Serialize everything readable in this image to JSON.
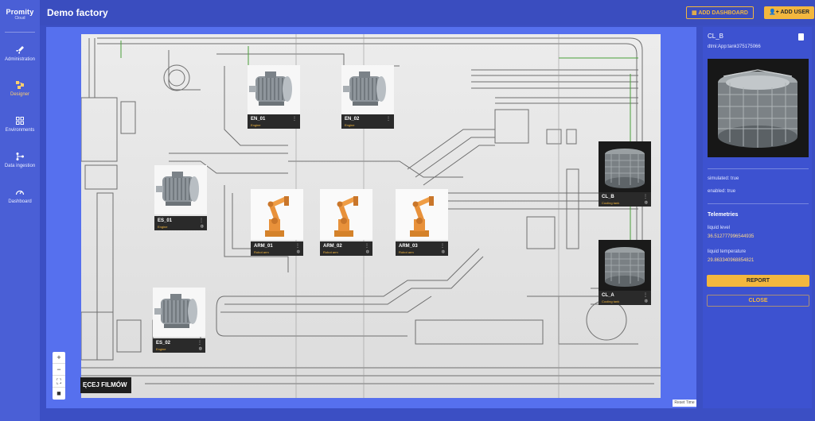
{
  "app": {
    "logo_text": "Promity",
    "logo_sub": "Cloud"
  },
  "sidebar": {
    "items": [
      {
        "label": "Administration",
        "icon": "rocket-icon"
      },
      {
        "label": "Designer",
        "icon": "designer-icon"
      },
      {
        "label": "Environments",
        "icon": "grid-icon"
      },
      {
        "label": "Data ingestion",
        "icon": "flow-icon"
      },
      {
        "label": "Dashboard",
        "icon": "gauge-icon"
      }
    ]
  },
  "header": {
    "title": "Demo factory",
    "add_dashboard": "ADD DASHBOARD",
    "add_user": "ADD USER"
  },
  "canvas": {
    "zoom_in": "+",
    "zoom_out": "−",
    "fit": "⛶",
    "lock": "🔒",
    "watermark": "ĘCEJ FILMÓW",
    "reset": "Reset Time"
  },
  "nodes": [
    {
      "name": "EN_01",
      "sub": "Engine",
      "type": "motor"
    },
    {
      "name": "EN_02",
      "sub": "Engine",
      "type": "motor"
    },
    {
      "name": "ES_01",
      "sub": "Engine",
      "type": "motor"
    },
    {
      "name": "ES_02",
      "sub": "Engine",
      "type": "motor"
    },
    {
      "name": "ARM_01",
      "sub": "Robot arm",
      "type": "arm"
    },
    {
      "name": "ARM_02",
      "sub": "Robot arm",
      "type": "arm"
    },
    {
      "name": "ARM_03",
      "sub": "Robot arm",
      "type": "arm"
    },
    {
      "name": "CL_B",
      "sub": "Cooling tank",
      "type": "tank"
    },
    {
      "name": "CL_A",
      "sub": "Cooling tank",
      "type": "tank"
    }
  ],
  "panel": {
    "title": "CL_B",
    "id": "dtmi:App:tank375175066",
    "simulated": "simulated: true",
    "enabled": "enabled: true",
    "telemetries_heading": "Telemetries",
    "telemetries": [
      {
        "label": "liquid level",
        "value": "36.512777996544935"
      },
      {
        "label": "liquid temperature",
        "value": "29.863340968854821"
      }
    ],
    "report": "REPORT",
    "close": "CLOSE"
  },
  "colors": {
    "accent": "#f3b73e",
    "sidebar": "#4a5fd6",
    "header": "#3a4dbf",
    "panel": "#3d52d0"
  }
}
